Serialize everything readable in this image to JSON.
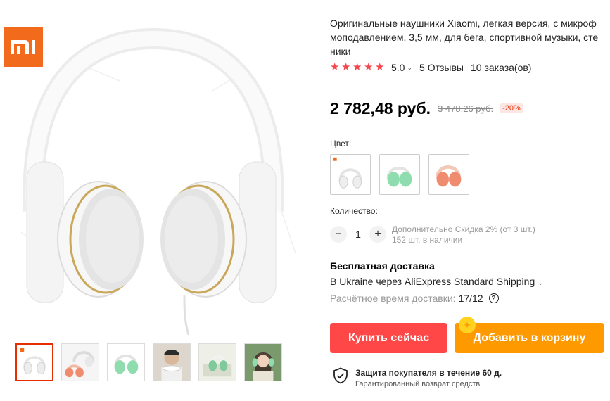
{
  "brand_logo": "MI",
  "product": {
    "title": "Оригинальные наушники Xiaomi, легкая версия, с микрофоном\nмоподавлением, 3,5 мм, для бега, спортивной музыки, стереонаушники",
    "title_visible": "Оригинальные наушники Xiaomi, легкая версия, с микроф\nмоподавлением, 3,5 мм, для бега, спортивной музыки, сте\nники"
  },
  "rating": {
    "stars": 5,
    "score": "5.0",
    "reviews": "5 Отзывы",
    "orders": "10 заказа(ов)"
  },
  "price": {
    "current": "2 782,48 руб.",
    "original": "3 478,26 руб.",
    "discount": "-20%"
  },
  "color": {
    "label": "Цвет:",
    "options": [
      "white",
      "green",
      "pink"
    ]
  },
  "quantity": {
    "label": "Количество:",
    "minus": "−",
    "value": "1",
    "plus": "+",
    "note_line1": "Дополнительно Скидка 2% (от 3 шт.)",
    "note_line2": "152 шт. в наличии"
  },
  "shipping": {
    "title": "Бесплатная доставка",
    "line": "В Ukraine через AliExpress Standard Shipping",
    "time_label": "Расчётное время доставки:",
    "time_date": "17/12",
    "help": "?"
  },
  "actions": {
    "buy_now": "Купить сейчас",
    "add_to_cart": "Добавить в корзину"
  },
  "protection": {
    "title": "Защита покупателя в течение 60 д.",
    "subtitle": "Гарантированный возврат средств"
  },
  "thumbnails": [
    "white-headphones",
    "white-pink-headphones",
    "green-headphones",
    "man-wearing-headphones",
    "green-headphones-scene",
    "woman-wearing-headphones"
  ],
  "colors": {
    "accent_red": "#ff4747",
    "accent_orange": "#ff9900",
    "star": "#f5464e",
    "mi_brand": "#f26a1b"
  }
}
